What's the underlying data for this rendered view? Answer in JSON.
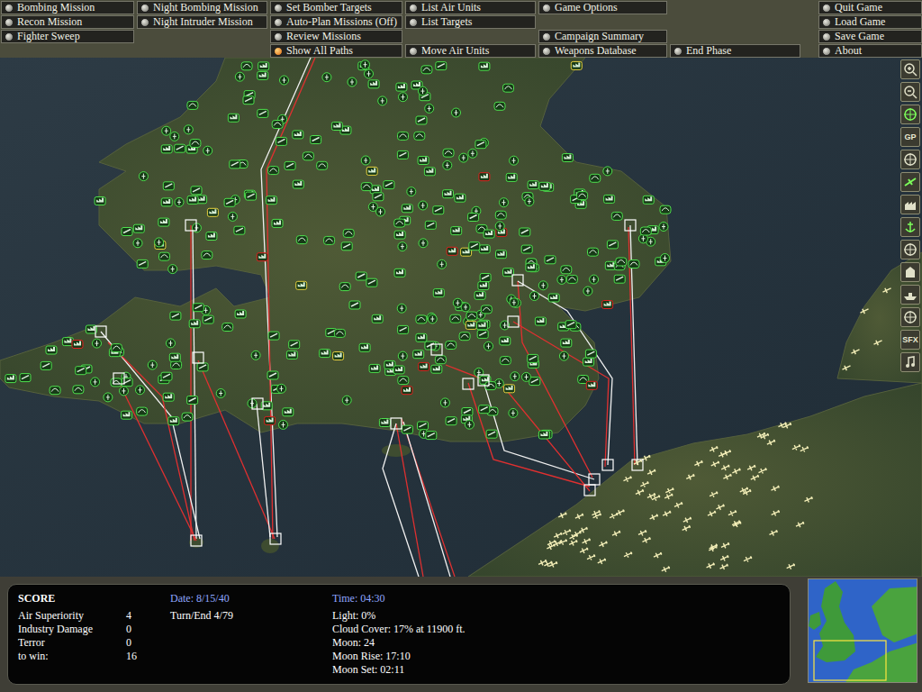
{
  "menu": [
    {
      "label": "Bombing Mission",
      "selected": false
    },
    {
      "label": "Recon Mission",
      "selected": false
    },
    {
      "label": "Fighter Sweep",
      "selected": false
    },
    {
      "label": "Night Bombing Mission",
      "selected": false
    },
    {
      "label": "Night Intruder Mission",
      "selected": false
    },
    {
      "label": "Set Bomber Targets",
      "selected": false
    },
    {
      "label": "Auto-Plan Missions (Off)",
      "selected": false
    },
    {
      "label": "Review Missions",
      "selected": false
    },
    {
      "label": "Show All Paths",
      "selected": true
    },
    {
      "label": "List Air Units",
      "selected": false
    },
    {
      "label": "List Targets",
      "selected": false
    },
    {
      "label": "Move Air Units",
      "selected": false
    },
    {
      "label": "Game Options",
      "selected": false
    },
    {
      "label": "Campaign Summary",
      "selected": false
    },
    {
      "label": "Weapons Database",
      "selected": false
    },
    {
      "label": "End Phase",
      "selected": false
    },
    {
      "label": "Quit Game",
      "selected": false
    },
    {
      "label": "Load Game",
      "selected": false
    },
    {
      "label": "Save Game",
      "selected": false
    },
    {
      "label": "About",
      "selected": false
    }
  ],
  "toolbar": {
    "gp": "GP",
    "sfx": "SFX"
  },
  "score": {
    "title": "SCORE",
    "rows": [
      {
        "label": "Air Superiority",
        "value": "4"
      },
      {
        "label": "Industry Damage",
        "value": "0"
      },
      {
        "label": "Terror",
        "value": "0"
      },
      {
        "label": "to win:",
        "value": "16"
      }
    ]
  },
  "date": "Date: 8/15/40",
  "turn": "Turn/End 4/79",
  "time": "Time: 04:30",
  "conditions": [
    "Light: 0%",
    "Cloud Cover: 17% at 11900 ft.",
    "Moon: 24",
    "Moon Rise: 17:10",
    "Moon Set: 02:11"
  ]
}
